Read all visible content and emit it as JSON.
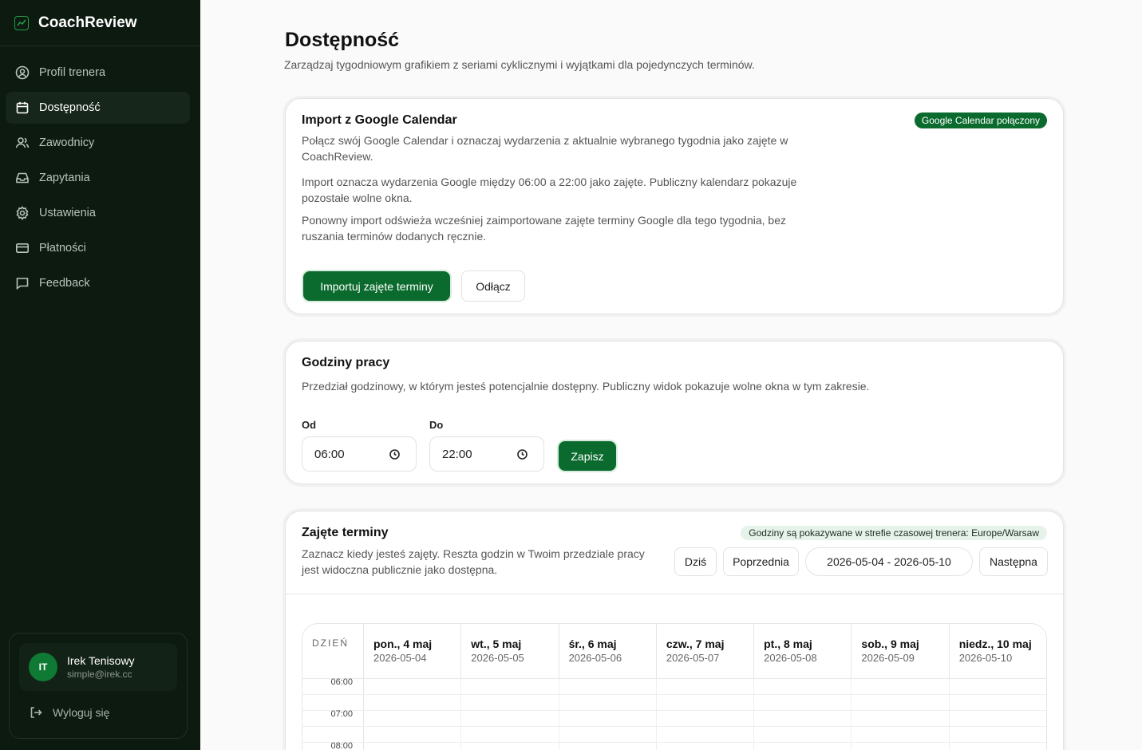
{
  "app": {
    "name": "CoachReview"
  },
  "sidebar": {
    "items": [
      {
        "label": "Profil trenera",
        "icon": "user-circle-icon"
      },
      {
        "label": "Dostępność",
        "icon": "calendar-icon",
        "active": true
      },
      {
        "label": "Zawodnicy",
        "icon": "users-icon"
      },
      {
        "label": "Zapytania",
        "icon": "inbox-icon"
      },
      {
        "label": "Ustawienia",
        "icon": "gear-icon"
      },
      {
        "label": "Płatności",
        "icon": "credit-card-icon"
      },
      {
        "label": "Feedback",
        "icon": "message-icon"
      }
    ],
    "user": {
      "initials": "IT",
      "name": "Irek Tenisowy",
      "email": "simple@irek.cc"
    },
    "logout_label": "Wyloguj się"
  },
  "page": {
    "title": "Dostępność",
    "subtitle": "Zarządzaj tygodniowym grafikiem z seriami cyklicznymi i wyjątkami dla pojedynczych terminów."
  },
  "google": {
    "title": "Import z Google Calendar",
    "badge": "Google Calendar połączony",
    "text1": "Połącz swój Google Calendar i oznaczaj wydarzenia z aktualnie wybranego tygodnia jako zajęte w CoachReview.",
    "text2": "Import oznacza wydarzenia Google między 06:00 a 22:00 jako zajęte. Publiczny kalendarz pokazuje pozostałe wolne okna.",
    "text3": "Ponowny import odświeża wcześniej zaimportowane zajęte terminy Google dla tego tygodnia, bez ruszania terminów dodanych ręcznie.",
    "import_label": "Importuj zajęte terminy",
    "disconnect_label": "Odłącz"
  },
  "hours": {
    "title": "Godziny pracy",
    "text": "Przedział godzinowy, w którym jesteś potencjalnie dostępny. Publiczny widok pokazuje wolne okna w tym zakresie.",
    "from_label": "Od",
    "from_value": "06:00",
    "to_label": "Do",
    "to_value": "22:00",
    "save_label": "Zapisz"
  },
  "busy": {
    "title": "Zajęte terminy",
    "tz_badge": "Godziny są pokazywane w strefie czasowej trenera: Europe/Warsaw",
    "text": "Zaznacz kiedy jesteś zajęty. Reszta godzin w Twoim przedziale pracy jest widoczna publicznie jako dostępna.",
    "today_label": "Dziś",
    "prev_label": "Poprzednia",
    "range_label": "2026-05-04 - 2026-05-10",
    "next_label": "Następna",
    "day_header": "DZIEŃ",
    "days": [
      {
        "name": "pon., 4 maj",
        "date": "2026-05-04"
      },
      {
        "name": "wt., 5 maj",
        "date": "2026-05-05"
      },
      {
        "name": "śr., 6 maj",
        "date": "2026-05-06"
      },
      {
        "name": "czw., 7 maj",
        "date": "2026-05-07"
      },
      {
        "name": "pt., 8 maj",
        "date": "2026-05-08"
      },
      {
        "name": "sob., 9 maj",
        "date": "2026-05-09"
      },
      {
        "name": "niedz., 10 maj",
        "date": "2026-05-10"
      }
    ],
    "times": [
      "06:00",
      "",
      "07:00",
      "",
      "08:00",
      ""
    ]
  }
}
